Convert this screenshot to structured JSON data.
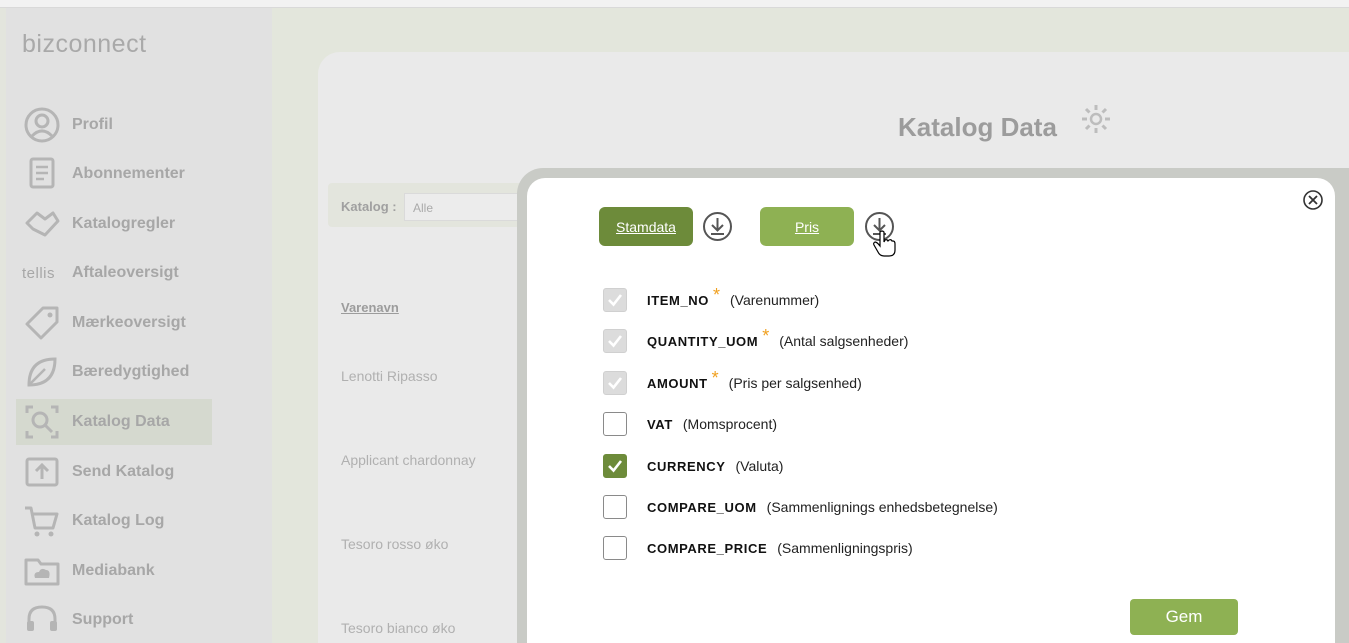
{
  "app": {
    "logo_text": "bizconnect"
  },
  "sidebar": {
    "items": [
      {
        "label": "Profil",
        "icon": "profile-icon"
      },
      {
        "label": "Abonnementer",
        "icon": "document-icon"
      },
      {
        "label": "Katalogregler",
        "icon": "handshake-icon"
      },
      {
        "label": "Aftaleoversigt",
        "icon": "tellis-logo",
        "prefix": "tellis"
      },
      {
        "label": "Mærkeoversigt",
        "icon": "tag-icon"
      },
      {
        "label": "Bæredygtighed",
        "icon": "leaf-icon"
      },
      {
        "label": "Katalog Data",
        "icon": "search-icon",
        "active": true
      },
      {
        "label": "Send Katalog",
        "icon": "upload-icon"
      },
      {
        "label": "Katalog Log",
        "icon": "cart-icon"
      },
      {
        "label": "Mediabank",
        "icon": "folder-cloud-icon"
      },
      {
        "label": "Support",
        "icon": "headset-icon"
      }
    ]
  },
  "main": {
    "title": "Katalog Data",
    "filter_label": "Katalog :",
    "filter_value": "Alle",
    "column_header": "Varenavn",
    "rows": [
      "Lenotti Ripasso",
      "Applicant chardonnay",
      "Tesoro rosso øko",
      "Tesoro bianco øko"
    ]
  },
  "modal": {
    "tabs": [
      {
        "label": "Stamdata",
        "active": true
      },
      {
        "label": "Pris",
        "active": false
      }
    ],
    "fields": [
      {
        "name": "ITEM_NO",
        "desc": "(Varenummer)",
        "required": true,
        "state": "disabled"
      },
      {
        "name": "QUANTITY_UOM",
        "desc": "(Antal salgsenheder)",
        "required": true,
        "state": "disabled"
      },
      {
        "name": "AMOUNT",
        "desc": "(Pris per salgsenhed)",
        "required": true,
        "state": "disabled"
      },
      {
        "name": "VAT",
        "desc": "(Momsprocent)",
        "required": false,
        "state": "unchecked"
      },
      {
        "name": "CURRENCY",
        "desc": "(Valuta)",
        "required": false,
        "state": "checked"
      },
      {
        "name": "COMPARE_UOM",
        "desc": "(Sammenlignings enhedsbetegnelse)",
        "required": false,
        "state": "unchecked"
      },
      {
        "name": "COMPARE_PRICE",
        "desc": "(Sammenligningspris)",
        "required": false,
        "state": "unchecked"
      }
    ],
    "required_mark": "*",
    "save_label": "Gem"
  },
  "colors": {
    "primary_green": "#6d8b3a",
    "light_green": "#8eb153",
    "required": "#f0a020"
  }
}
